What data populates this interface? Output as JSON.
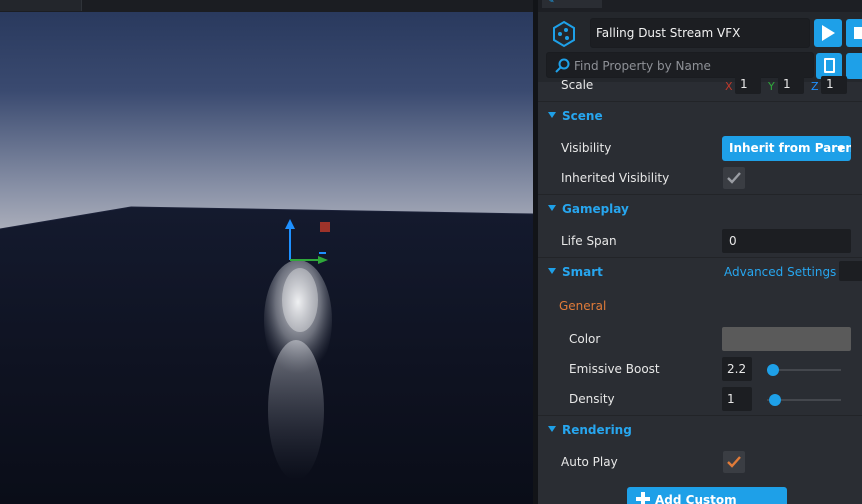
{
  "object_name": "Falling Dust Stream VFX",
  "search": {
    "placeholder": "Find Property by Name"
  },
  "scale": {
    "label": "Scale",
    "axes": [
      "X",
      "Y",
      "Z"
    ],
    "values": [
      "1",
      "1",
      "1"
    ]
  },
  "sections": {
    "scene": "Scene",
    "gameplay": "Gameplay",
    "smart": "Smart",
    "rendering": "Rendering"
  },
  "scene": {
    "visibility_label": "Visibility",
    "visibility_value": "Inherit from Parent",
    "inherited_visibility_label": "Inherited Visibility",
    "inherited_visibility_checked": true
  },
  "gameplay": {
    "life_span_label": "Life Span",
    "life_span_value": "0"
  },
  "smart": {
    "advanced_settings": "Advanced Settings",
    "group_label": "General",
    "color_label": "Color",
    "color_value": "#5a5a5a",
    "emissive_boost_label": "Emissive Boost",
    "emissive_boost_value": "2.2",
    "emissive_boost_fraction": 0.08,
    "density_label": "Density",
    "density_value": "1",
    "density_fraction": 0.11
  },
  "rendering": {
    "auto_play_label": "Auto Play",
    "auto_play_checked": true
  },
  "add_custom_property": "Add Custom Property",
  "colors": {
    "accent": "#1ea0e8",
    "section_title": "#27a6ef",
    "group_label": "#e07b39",
    "gizmo_y": "#1e90ff",
    "gizmo_x": "#2fa83a",
    "gizmo_z": "#c0392b"
  }
}
